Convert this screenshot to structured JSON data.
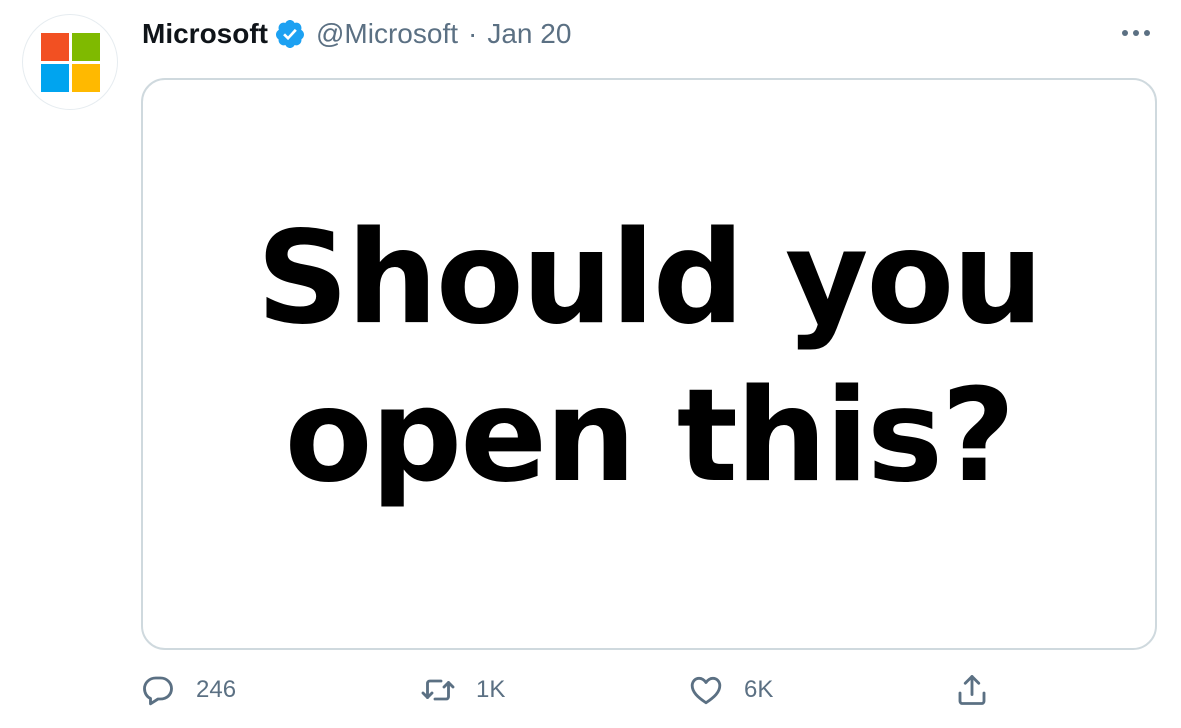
{
  "tweet": {
    "display_name": "Microsoft",
    "handle": "@Microsoft",
    "separator": "·",
    "date": "Jan 20",
    "verified_icon": "verified-badge-icon",
    "more_icon": "more-horizontal-icon",
    "media_lines": [
      "Should you",
      "open this?"
    ]
  },
  "logo": {
    "colors": [
      "#f25022",
      "#7fba00",
      "#00a4ef",
      "#ffb900"
    ]
  },
  "actions": {
    "reply": {
      "icon": "reply-icon",
      "count": "246"
    },
    "retweet": {
      "icon": "retweet-icon",
      "count": "1K"
    },
    "like": {
      "icon": "heart-icon",
      "count": "6K"
    },
    "share": {
      "icon": "share-icon"
    }
  },
  "colors": {
    "verified_blue": "#1da1f2",
    "secondary_text": "#5b7083",
    "card_border": "#cfd9de"
  }
}
